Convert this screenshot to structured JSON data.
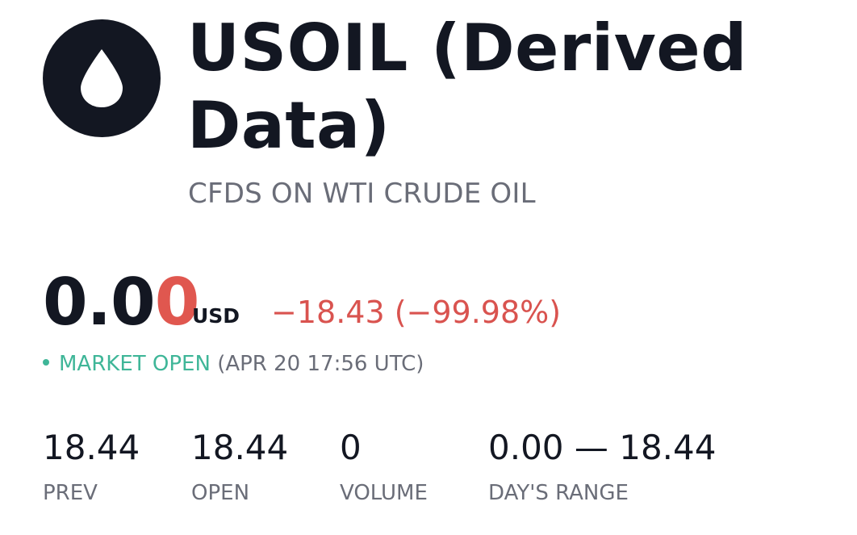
{
  "header": {
    "logo_icon": "oil-drop-icon",
    "title": "USOIL (Derived Data)",
    "subtitle": "CFDS ON WTI CRUDE OIL"
  },
  "quote": {
    "price_prefix": "0.0",
    "price_last_digit": "0",
    "currency": "USD",
    "change": "−18.43 (−99.98%)"
  },
  "market": {
    "status": "MARKET OPEN",
    "timestamp": "(APR 20 17:56 UTC)"
  },
  "stats": [
    {
      "value": "18.44",
      "label": "PREV"
    },
    {
      "value": "18.44",
      "label": "OPEN"
    },
    {
      "value": "0",
      "label": "VOLUME"
    },
    {
      "value": "0.00 — 18.44",
      "label": "DAY'S RANGE"
    }
  ],
  "colors": {
    "text": "#131722",
    "muted": "#6a6d78",
    "negative": "#e0574f",
    "positive": "#3fb698"
  }
}
